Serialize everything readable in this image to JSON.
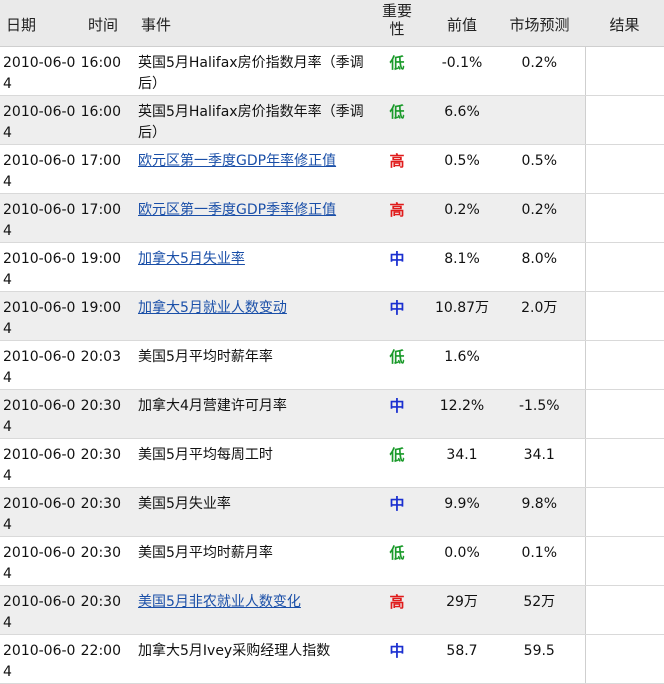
{
  "headers": {
    "date": "日期",
    "time": "时间",
    "event": "事件",
    "importance": "重要性",
    "previous": "前值",
    "forecast": "市场预测",
    "result": "结果"
  },
  "colors": {
    "低": "#1a9a2a",
    "中": "#1a2fd0",
    "高": "#e01b1b",
    "link": "#1a4fa8"
  },
  "rows": [
    {
      "date": "2010-06-04",
      "time": "16:00",
      "event": "英国5月Halifax房价指数月率（季调后）",
      "link": false,
      "importance": "低",
      "previous": "-0.1%",
      "forecast": "0.2%",
      "result": ""
    },
    {
      "date": "2010-06-04",
      "time": "16:00",
      "event": "英国5月Halifax房价指数年率（季调后）",
      "link": false,
      "importance": "低",
      "previous": "6.6%",
      "forecast": "",
      "result": ""
    },
    {
      "date": "2010-06-04",
      "time": "17:00",
      "event": "欧元区第一季度GDP年率修正值",
      "link": true,
      "importance": "高",
      "previous": "0.5%",
      "forecast": "0.5%",
      "result": ""
    },
    {
      "date": "2010-06-04",
      "time": "17:00",
      "event": "欧元区第一季度GDP季率修正值",
      "link": true,
      "importance": "高",
      "previous": "0.2%",
      "forecast": "0.2%",
      "result": ""
    },
    {
      "date": "2010-06-04",
      "time": "19:00",
      "event": "加拿大5月失业率",
      "link": true,
      "importance": "中",
      "previous": "8.1%",
      "forecast": "8.0%",
      "result": ""
    },
    {
      "date": "2010-06-04",
      "time": "19:00",
      "event": "加拿大5月就业人数变动",
      "link": true,
      "importance": "中",
      "previous": "10.87万",
      "forecast": "2.0万",
      "result": ""
    },
    {
      "date": "2010-06-04",
      "time": "20:03",
      "event": "美国5月平均时薪年率",
      "link": false,
      "importance": "低",
      "previous": "1.6%",
      "forecast": "",
      "result": ""
    },
    {
      "date": "2010-06-04",
      "time": "20:30",
      "event": "加拿大4月营建许可月率",
      "link": false,
      "importance": "中",
      "previous": "12.2%",
      "forecast": "-1.5%",
      "result": ""
    },
    {
      "date": "2010-06-04",
      "time": "20:30",
      "event": "美国5月平均每周工时",
      "link": false,
      "importance": "低",
      "previous": "34.1",
      "forecast": "34.1",
      "result": ""
    },
    {
      "date": "2010-06-04",
      "time": "20:30",
      "event": "美国5月失业率",
      "link": false,
      "importance": "中",
      "previous": "9.9%",
      "forecast": "9.8%",
      "result": ""
    },
    {
      "date": "2010-06-04",
      "time": "20:30",
      "event": "美国5月平均时薪月率",
      "link": false,
      "importance": "低",
      "previous": "0.0%",
      "forecast": "0.1%",
      "result": ""
    },
    {
      "date": "2010-06-04",
      "time": "20:30",
      "event": "美国5月非农就业人数变化",
      "link": true,
      "importance": "高",
      "previous": "29万",
      "forecast": "52万",
      "result": ""
    },
    {
      "date": "2010-06-04",
      "time": "22:00",
      "event": "加拿大5月Ivey采购经理人指数",
      "link": false,
      "importance": "中",
      "previous": "58.7",
      "forecast": "59.5",
      "result": ""
    }
  ]
}
